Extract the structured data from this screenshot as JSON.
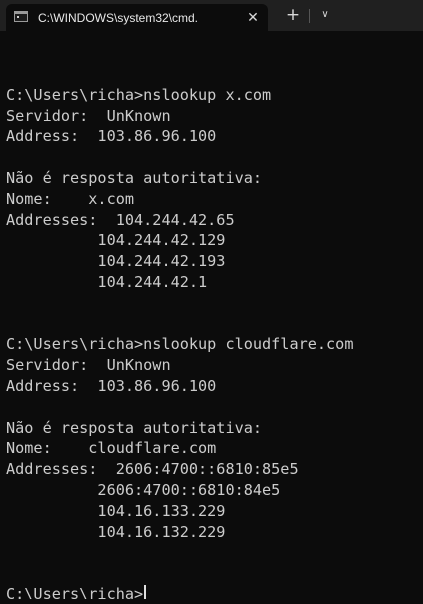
{
  "tab": {
    "title": "C:\\WINDOWS\\system32\\cmd.",
    "close_glyph": "✕",
    "icon": "cmd-icon"
  },
  "toolbar": {
    "new_tab_glyph": "+",
    "dropdown_glyph": "∨"
  },
  "terminal": {
    "lines": [
      "",
      "C:\\Users\\richa>nslookup x.com",
      "Servidor:  UnKnown",
      "Address:  103.86.96.100",
      "",
      "Não é resposta autoritativa:",
      "Nome:    x.com",
      "Addresses:  104.244.42.65",
      "          104.244.42.129",
      "          104.244.42.193",
      "          104.244.42.1",
      "",
      "",
      "C:\\Users\\richa>nslookup cloudflare.com",
      "Servidor:  UnKnown",
      "Address:  103.86.96.100",
      "",
      "Não é resposta autoritativa:",
      "Nome:    cloudflare.com",
      "Addresses:  2606:4700::6810:85e5",
      "          2606:4700::6810:84e5",
      "          104.16.133.229",
      "          104.16.132.229",
      "",
      "",
      "C:\\Users\\richa>"
    ]
  }
}
